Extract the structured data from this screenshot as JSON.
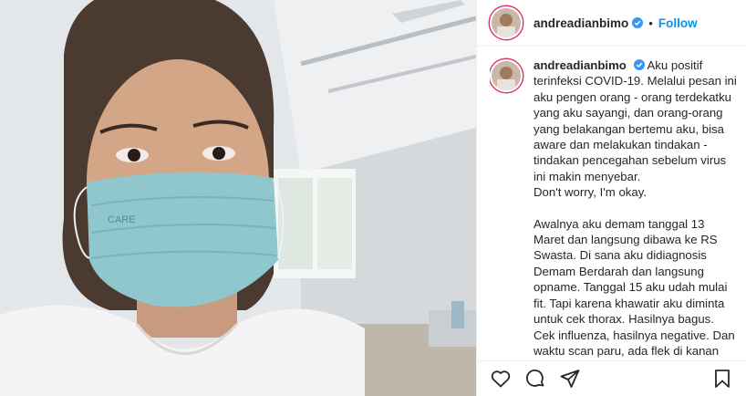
{
  "header": {
    "username": "andreadianbimo",
    "separator": "•",
    "follow_label": "Follow"
  },
  "photo": {
    "mask_brand": "CARE"
  },
  "caption": {
    "username": "andreadianbimo",
    "paragraph1": "Aku positif terinfeksi COVID-19. Melalui pesan ini aku pengen orang - orang terdekatku yang aku sayangi, dan orang-orang yang belakangan bertemu aku, bisa aware dan melakukan tindakan - tindakan pencegahan sebelum virus ini makin menyebar.",
    "paragraph1b": "Don't worry, I'm okay.",
    "paragraph2": "Awalnya aku demam tanggal 13 Maret dan langsung dibawa ke RS Swasta. Di sana aku didiagnosis Demam Berdarah dan langsung opname. Tanggal 15 aku udah mulai fit. Tapi karena khawatir aku diminta untuk cek thorax. Hasilnya bagus. Cek influenza, hasilnya negative. Dan waktu scan paru, ada flek di kanan dan kiri. Karena ada flek maka"
  },
  "actions": {
    "like_icon": "heart-icon",
    "comment_icon": "comment-icon",
    "share_icon": "paper-plane-icon",
    "save_icon": "bookmark-icon"
  },
  "colors": {
    "follow": "#0095f6",
    "verified": "#3897f0",
    "mask": "#8fc7cd"
  }
}
